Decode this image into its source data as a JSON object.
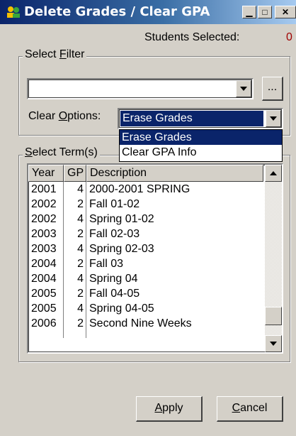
{
  "window": {
    "title": "Delete Grades / Clear GPA",
    "minimize_icon": "minimize-icon",
    "maximize_icon": "maximize-icon",
    "close_icon": "close-icon"
  },
  "students_selected": {
    "label": "Students Selected:",
    "count": "0"
  },
  "select_filter": {
    "group_label_prefix": "Select ",
    "group_label_access": "F",
    "group_label_suffix": "ilter",
    "value": "",
    "browse_label": "..."
  },
  "clear_options": {
    "label_prefix": "Clear ",
    "label_access": "O",
    "label_suffix": "ptions:",
    "selected": "Erase Grades",
    "options": [
      "Erase Grades",
      "Clear GPA Info"
    ]
  },
  "terms": {
    "group_label_prefix": "",
    "group_label_access": "S",
    "group_label_suffix": "elect Term(s)",
    "columns": {
      "year": "Year",
      "gp": "GP",
      "description": "Description"
    },
    "rows": [
      {
        "year": "2001",
        "gp": "4",
        "description": "2000-2001 SPRING"
      },
      {
        "year": "2002",
        "gp": "2",
        "description": "Fall 01-02"
      },
      {
        "year": "2002",
        "gp": "4",
        "description": "Spring 01-02"
      },
      {
        "year": "2003",
        "gp": "2",
        "description": "Fall 02-03"
      },
      {
        "year": "2003",
        "gp": "4",
        "description": "Spring 02-03"
      },
      {
        "year": "2004",
        "gp": "2",
        "description": "Fall 03"
      },
      {
        "year": "2004",
        "gp": "4",
        "description": "Spring 04"
      },
      {
        "year": "2005",
        "gp": "2",
        "description": "Fall 04-05"
      },
      {
        "year": "2005",
        "gp": "4",
        "description": "Spring 04-05"
      },
      {
        "year": "2006",
        "gp": "2",
        "description": "Second Nine Weeks"
      }
    ]
  },
  "buttons": {
    "apply_access": "A",
    "apply_rest": "pply",
    "cancel_access": "C",
    "cancel_rest": "ancel"
  }
}
